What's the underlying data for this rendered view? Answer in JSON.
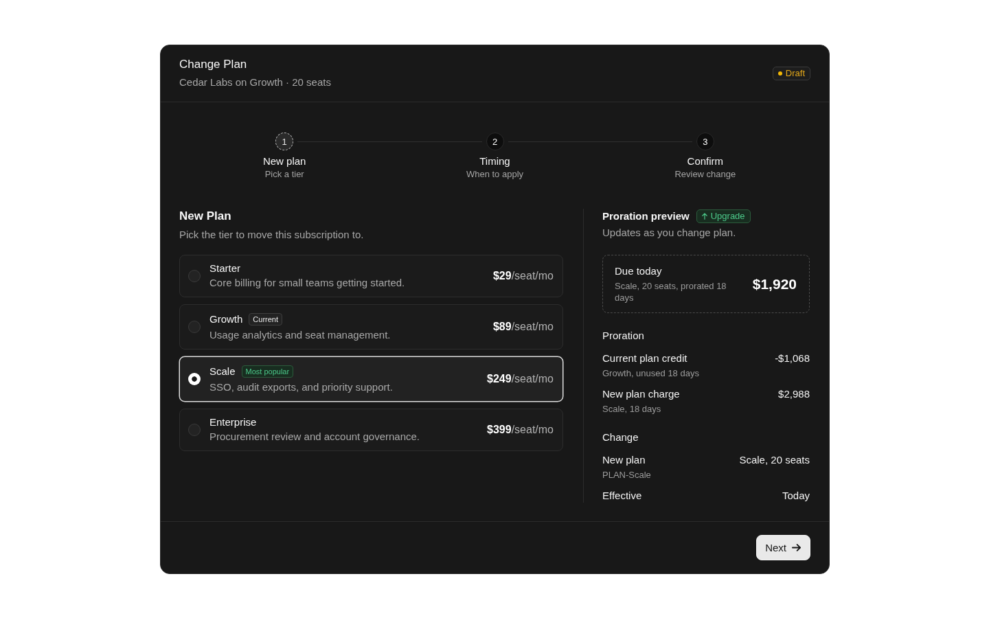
{
  "dialog": {
    "title": "Change Plan",
    "subtitle": "Cedar Labs on Growth · 20 seats",
    "status": {
      "text": "Draft",
      "kind": "warning"
    }
  },
  "stepper": {
    "steps": [
      {
        "number": "1",
        "title": "New plan",
        "subtitle": "Pick a tier",
        "current": true
      },
      {
        "number": "2",
        "title": "Timing",
        "subtitle": "When to apply",
        "current": false
      },
      {
        "number": "3",
        "title": "Confirm",
        "subtitle": "Review change",
        "current": false
      }
    ]
  },
  "plan_picker": {
    "title": "New Plan",
    "subtitle": "Pick the tier to move this subscription to.",
    "plans": [
      {
        "name": "Starter",
        "description": "Core billing for small teams getting started.",
        "price": "**$29**/seat/mo",
        "selected": false
      },
      {
        "name": "Growth",
        "badge": {
          "text": "Current",
          "kind": "neutral"
        },
        "description": "Usage analytics and seat management.",
        "price": "**$89**/seat/mo",
        "selected": false
      },
      {
        "name": "Scale",
        "badge": {
          "text": "Most popular",
          "kind": "success"
        },
        "description": "SSO, audit exports, and priority support.",
        "price": "**$249**/seat/mo",
        "selected": true
      },
      {
        "name": "Enterprise",
        "description": "Procurement review and account governance.",
        "price": "**$399**/seat/mo",
        "selected": false
      }
    ]
  },
  "proration_preview": {
    "title": "Proration preview",
    "badge": {
      "text": "Upgrade",
      "kind": "success"
    },
    "subtitle": "Updates as you change plan.",
    "due_today": {
      "label": "Due today",
      "detail": "Scale, 20 seats, prorated 18 days",
      "amount": "$1,920"
    },
    "sections": [
      {
        "title": "Proration",
        "rows": [
          {
            "label": "Current plan credit",
            "detail": "Growth, unused 18 days",
            "value": "-$1,068"
          },
          {
            "label": "New plan charge",
            "detail": "Scale, 18 days",
            "value": "$2,988"
          }
        ]
      },
      {
        "title": "Change",
        "rows": [
          {
            "label": "New plan",
            "detail": "PLAN-Scale",
            "value": "Scale, 20 seats"
          },
          {
            "label": "Effective",
            "value": "Today"
          }
        ]
      }
    ]
  },
  "footer": {
    "next_button": {
      "label": "Next"
    }
  }
}
